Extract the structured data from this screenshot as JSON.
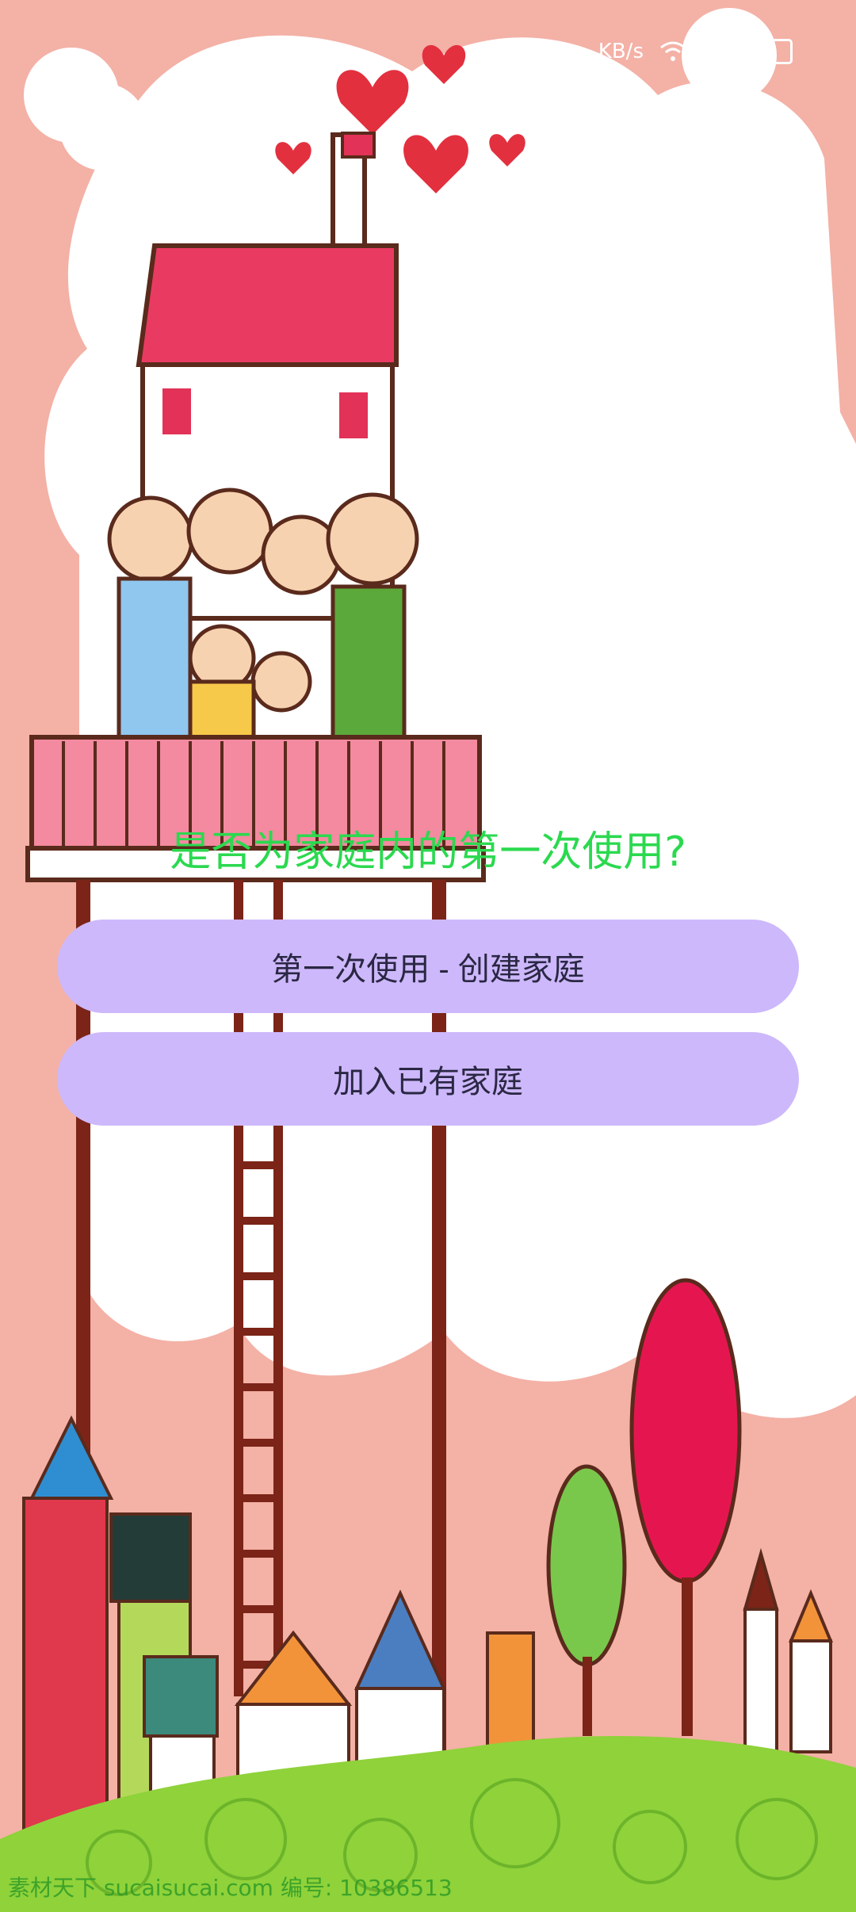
{
  "status_bar": {
    "wifi_icon": "wifi-icon",
    "call_icon": "phone-icon",
    "network_label": "KB/s"
  },
  "prompt": {
    "question": "是否为家庭内的第一次使用?"
  },
  "actions": {
    "create_family": "第一次使用 - 创建家庭",
    "join_family": "加入已有家庭"
  },
  "watermark": {
    "text": "素材天下 sucaisucai.com  编号: 10386513"
  },
  "colors": {
    "question_text": "#2bd94f",
    "button_bg": "#cdb8fb",
    "button_text": "#2a2743"
  }
}
